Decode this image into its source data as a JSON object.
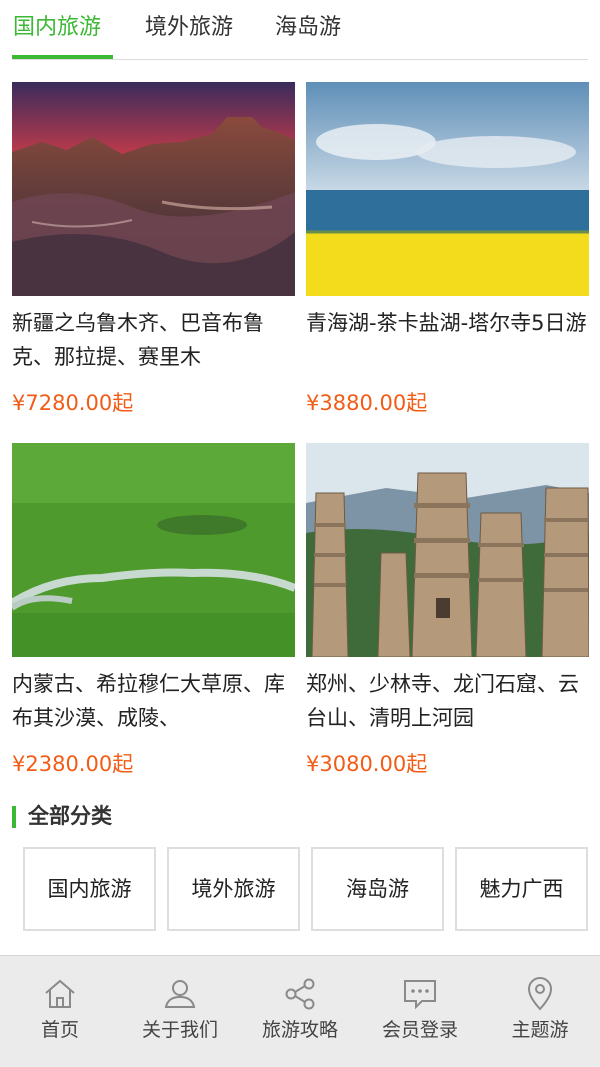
{
  "tabs": [
    {
      "label": "国内旅游",
      "active": true
    },
    {
      "label": "境外旅游",
      "active": false
    },
    {
      "label": "海岛游",
      "active": false
    }
  ],
  "products": [
    {
      "title": "新疆之乌鲁木齐、巴音布鲁克、那拉提、赛里木",
      "price": "¥7280.00起",
      "image": "red-rock-canyon-at-sunset"
    },
    {
      "title": "青海湖-茶卡盐湖-塔尔寺5日游",
      "price": "¥3880.00起",
      "image": "lake-with-yellow-rapeseed-field"
    },
    {
      "title": "内蒙古、希拉穆仁大草原、库布其沙漠、成陵、",
      "price": "¥2380.00起",
      "image": "green-grassland-with-river"
    },
    {
      "title": "郑州、少林寺、龙门石窟、云台山、清明上河园",
      "price": "¥3080.00起",
      "image": "shaolin-pagoda-forest"
    }
  ],
  "categories": {
    "heading": "全部分类",
    "items": [
      "国内旅游",
      "境外旅游",
      "海岛游",
      "魅力广西"
    ]
  },
  "bottom_nav": [
    {
      "label": "首页",
      "icon": "home-icon"
    },
    {
      "label": "关于我们",
      "icon": "user-icon"
    },
    {
      "label": "旅游攻略",
      "icon": "share-icon"
    },
    {
      "label": "会员登录",
      "icon": "chat-icon"
    },
    {
      "label": "主题游",
      "icon": "location-pin-icon"
    }
  ],
  "colors": {
    "accent": "#3cb834",
    "price": "#f25c16",
    "nav_bg": "#ebebeb"
  }
}
